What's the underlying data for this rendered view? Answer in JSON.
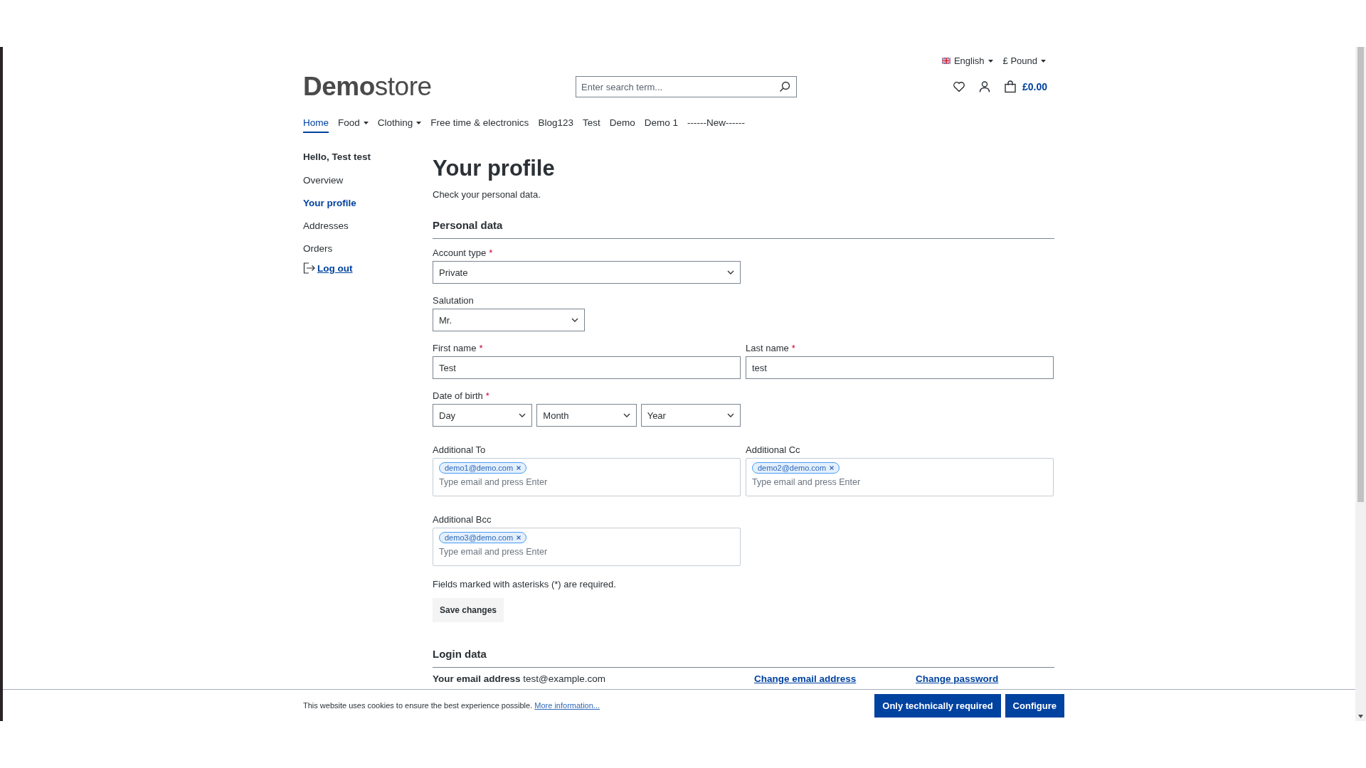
{
  "top_bar": {
    "language": "English",
    "currency": "£ Pound"
  },
  "header": {
    "logo_bold": "Demo",
    "logo_light": "store",
    "search": {
      "placeholder": "Enter search term..."
    },
    "cart_total": "£0.00"
  },
  "nav": [
    {
      "label": "Home",
      "selected": true,
      "dropdown": false
    },
    {
      "label": "Food",
      "selected": false,
      "dropdown": true
    },
    {
      "label": "Clothing",
      "selected": false,
      "dropdown": true
    },
    {
      "label": "Free time & electronics",
      "selected": false,
      "dropdown": false
    },
    {
      "label": "Blog123",
      "selected": false,
      "dropdown": false
    },
    {
      "label": "Test",
      "selected": false,
      "dropdown": false
    },
    {
      "label": "Demo",
      "selected": false,
      "dropdown": false
    },
    {
      "label": "Demo 1",
      "selected": false,
      "dropdown": false
    },
    {
      "label": "------New------",
      "selected": false,
      "dropdown": false
    }
  ],
  "sidebar": {
    "greeting": "Hello, Test test",
    "items": [
      {
        "label": "Overview",
        "selected": false
      },
      {
        "label": "Your profile",
        "selected": true
      },
      {
        "label": "Addresses",
        "selected": false
      },
      {
        "label": "Orders",
        "selected": false
      }
    ],
    "logout": "Log out"
  },
  "page": {
    "title": "Your profile",
    "subtitle": "Check your personal data."
  },
  "personal_data": {
    "heading": "Personal data",
    "required_marker": "*",
    "rows": [
      {
        "fields": [
          {
            "kind": "select",
            "label": "Account type",
            "required": true,
            "value": "Private"
          }
        ]
      },
      {
        "fields": [
          {
            "kind": "select-small",
            "label": "Salutation",
            "required": false,
            "value": "Mr."
          }
        ]
      },
      {
        "fields": [
          {
            "kind": "text",
            "label": "First name",
            "required": true,
            "value": "Test"
          },
          {
            "kind": "text",
            "label": "Last name",
            "required": true,
            "value": "test"
          }
        ]
      },
      {
        "fields": [
          {
            "kind": "date",
            "label": "Date of birth",
            "required": true,
            "parts": [
              "Day",
              "Month",
              "Year"
            ]
          }
        ]
      },
      {
        "fields": [
          {
            "kind": "tags",
            "label": "Additional To",
            "required": false,
            "tags": [
              "demo1@demo.com"
            ],
            "placeholder": "Type email and press Enter"
          },
          {
            "kind": "tags",
            "label": "Additional Cc",
            "required": false,
            "tags": [
              "demo2@demo.com"
            ],
            "placeholder": "Type email and press Enter"
          }
        ]
      },
      {
        "fields": [
          {
            "kind": "tags",
            "label": "Additional Bcc",
            "required": false,
            "tags": [
              "demo3@demo.com"
            ],
            "placeholder": "Type email and press Enter"
          }
        ]
      }
    ],
    "footnote": "Fields marked with asterisks (*) are required.",
    "save_button": "Save changes"
  },
  "login_data": {
    "heading": "Login data",
    "email": "**Your email address** test@example.com",
    "change_email": "Change email address",
    "change_password": "Change password"
  },
  "cookie_bar": {
    "text": "This website uses cookies to ensure the best experience possible.",
    "link": "More information...",
    "buttons": [
      "Only technically required",
      "Configure"
    ]
  }
}
